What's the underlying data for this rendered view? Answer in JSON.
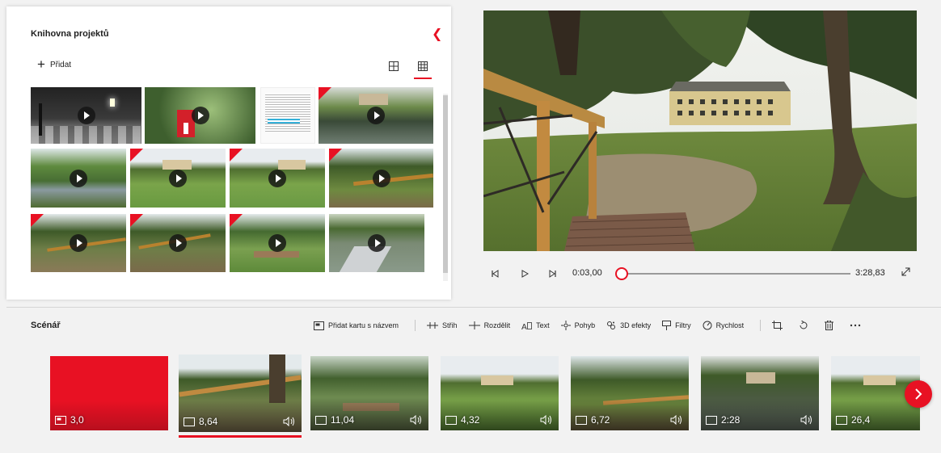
{
  "library": {
    "title": "Knihovna projektů",
    "add_label": "Přidat",
    "thumbnails": [
      {
        "name": "night-street",
        "has_red_corner": false,
        "is_video": true
      },
      {
        "name": "red-sign",
        "has_red_corner": false,
        "is_video": true
      },
      {
        "name": "document-page",
        "has_red_corner": false,
        "is_video": false
      },
      {
        "name": "pond-1",
        "has_red_corner": true,
        "is_video": true
      },
      {
        "name": "river",
        "has_red_corner": false,
        "is_video": true
      },
      {
        "name": "meadow-hotel-1",
        "has_red_corner": true,
        "is_video": true
      },
      {
        "name": "meadow-hotel-2",
        "has_red_corner": true,
        "is_video": true
      },
      {
        "name": "bridge-1",
        "has_red_corner": true,
        "is_video": true
      },
      {
        "name": "path-1",
        "has_red_corner": true,
        "is_video": true
      },
      {
        "name": "path-2",
        "has_red_corner": true,
        "is_video": true
      },
      {
        "name": "bench",
        "has_red_corner": true,
        "is_video": true
      },
      {
        "name": "pier",
        "has_red_corner": false,
        "is_video": true
      }
    ]
  },
  "player": {
    "current_time": "0:03,00",
    "total_time": "3:28,83",
    "progress": 0.0144
  },
  "storyboard": {
    "title": "Scénář",
    "toolbar": {
      "add_title_card": "Přidat kartu s názvem",
      "trim": "Střih",
      "split": "Rozdělit",
      "text": "Text",
      "motion": "Pohyb",
      "effects_3d": "3D efekty",
      "filters": "Filtry",
      "speed": "Rychlost"
    },
    "clips": [
      {
        "label": "3,0",
        "kind": "title-card",
        "audio": false,
        "selected": false
      },
      {
        "label": "8,64",
        "kind": "video",
        "audio": true,
        "selected": true
      },
      {
        "label": "11,04",
        "kind": "video",
        "audio": true,
        "selected": false
      },
      {
        "label": "4,32",
        "kind": "video",
        "audio": true,
        "selected": false
      },
      {
        "label": "6,72",
        "kind": "video",
        "audio": true,
        "selected": false
      },
      {
        "label": "2:28",
        "kind": "video",
        "audio": true,
        "selected": false
      },
      {
        "label": "26,4",
        "kind": "video",
        "audio": false,
        "selected": false
      }
    ]
  },
  "colors": {
    "accent": "#e81123"
  }
}
